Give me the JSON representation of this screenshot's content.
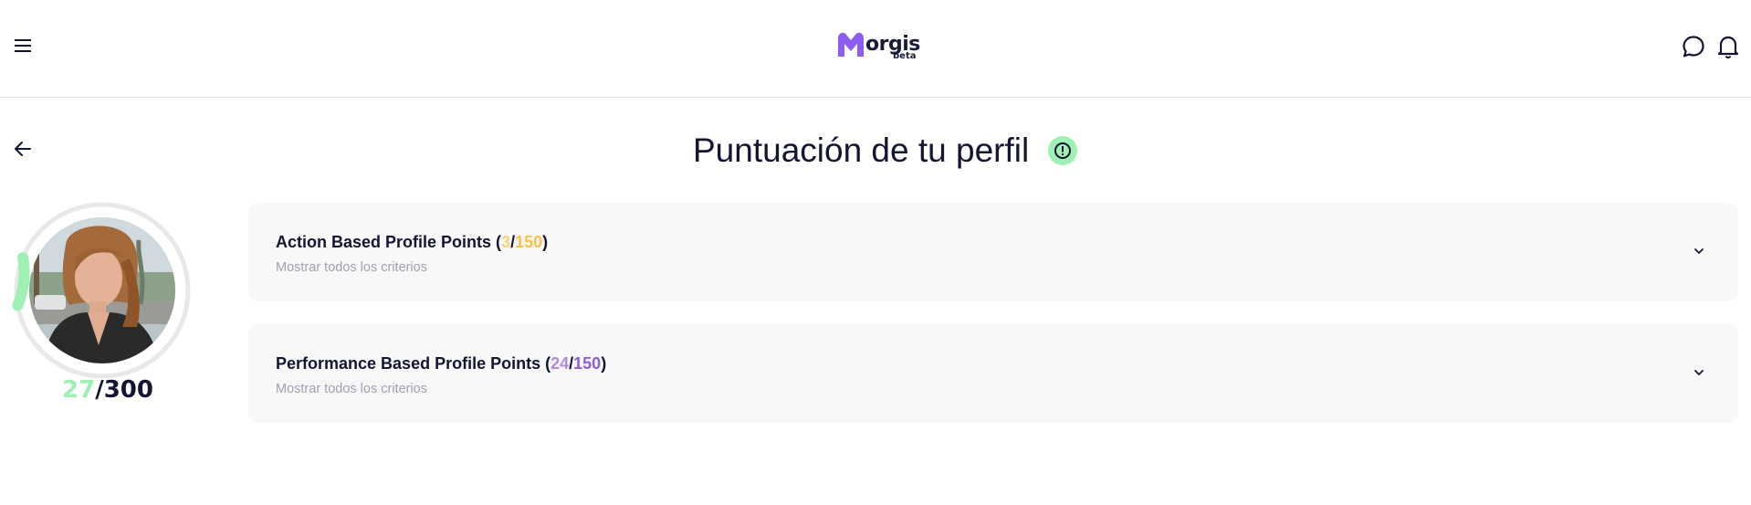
{
  "header": {
    "logo_text": "orgis",
    "logo_badge": "beta"
  },
  "page": {
    "title": "Puntuación de tu perfil"
  },
  "profile": {
    "score_current": "27",
    "score_separator": "/",
    "score_total": "300",
    "progress_fraction": 0.09
  },
  "cards": [
    {
      "title_prefix": "Action Based Profile Points (",
      "current": "3",
      "separator": "/",
      "total": "150",
      "title_suffix": ")",
      "subtitle": "Mostrar todos los criterios"
    },
    {
      "title_prefix": "Performance Based Profile Points (",
      "current": "24",
      "separator": "/",
      "total": "150",
      "title_suffix": ")",
      "subtitle": "Mostrar todos los criterios"
    }
  ],
  "colors": {
    "accent_green": "#9ff0b3",
    "accent_orange": "#ffbf47",
    "accent_purple": "#b188e8",
    "logo_purple": "#8e5cf0",
    "text_dark": "#141433"
  }
}
